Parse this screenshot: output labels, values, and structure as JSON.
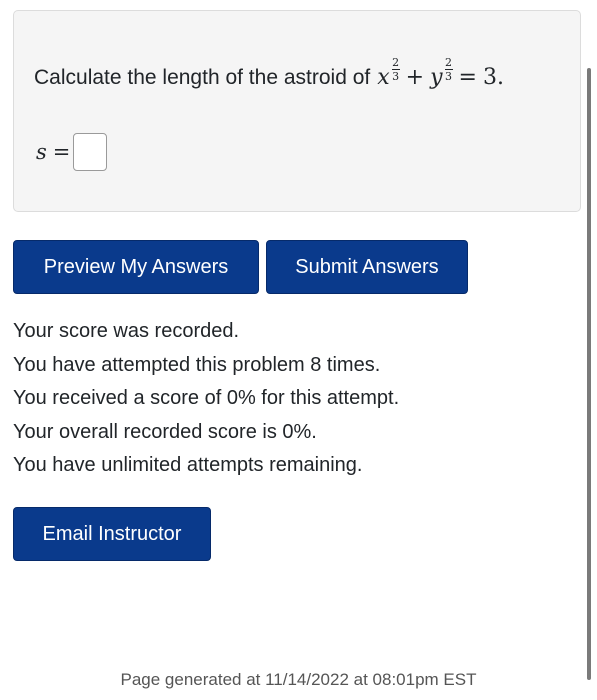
{
  "problem": {
    "question_text": "Calculate the length of the astroid of",
    "equation": {
      "var_x": "x",
      "exp_num": "2",
      "exp_den": "3",
      "plus": "+",
      "var_y": "y",
      "equals": "=",
      "rhs": "3."
    },
    "answer": {
      "variable": "s",
      "equals": "=",
      "value": ""
    }
  },
  "buttons": {
    "preview_label": "Preview My Answers",
    "submit_label": "Submit Answers",
    "email_label": "Email Instructor"
  },
  "status": {
    "line1": "Your score was recorded.",
    "line2": "You have attempted this problem 8 times.",
    "line3": "You received a score of 0% for this attempt.",
    "line4": "Your overall recorded score is 0%.",
    "line5": "You have unlimited attempts remaining."
  },
  "footer": {
    "text": "Page generated at 11/14/2022 at 08:01pm EST"
  },
  "colors": {
    "button_bg": "#0a3a8c",
    "panel_bg": "#f5f5f5"
  }
}
